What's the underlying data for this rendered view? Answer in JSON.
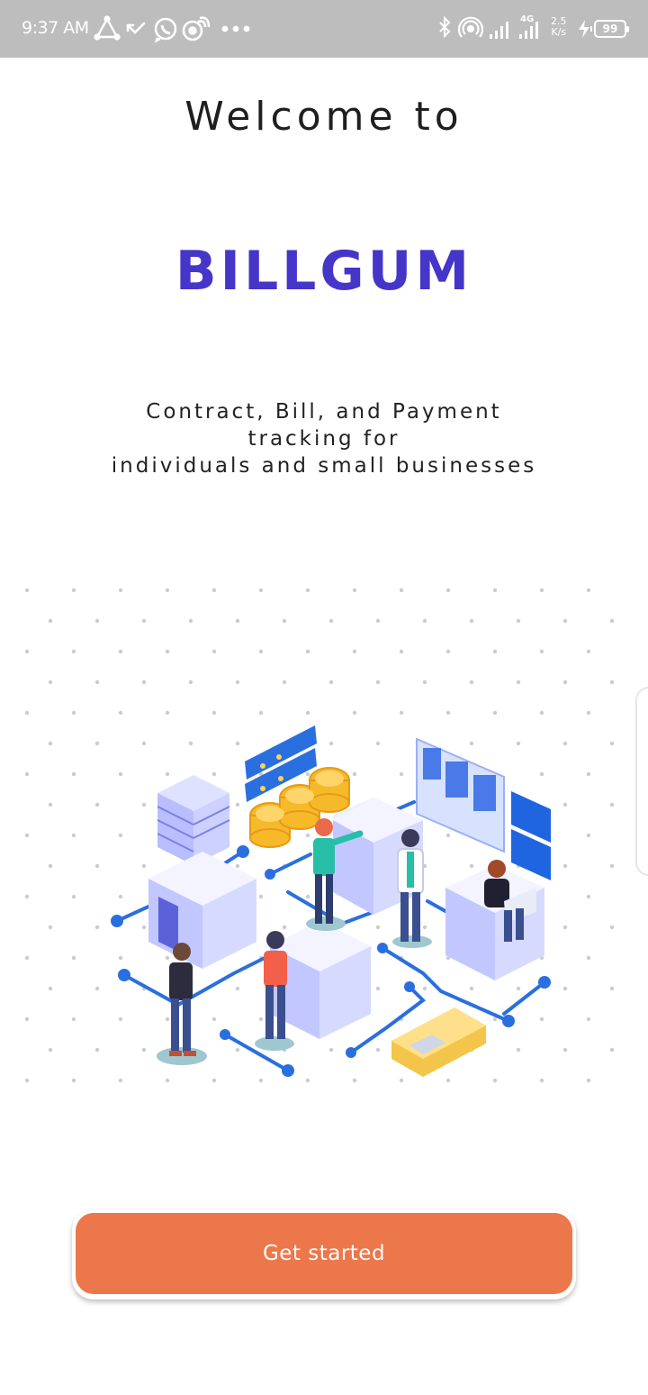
{
  "status_bar": {
    "time": "9:37 AM",
    "network_type": "4G",
    "net_speed_value": "2.5",
    "net_speed_unit": "K/s",
    "battery_level": "99",
    "icons": [
      "alert-triangle-icon",
      "missed-call-icon",
      "whatsapp-icon",
      "sync-icon",
      "more-dots-icon",
      "bluetooth-icon",
      "hotspot-icon",
      "signal-icon",
      "signal-4g-icon",
      "charging-icon",
      "battery-icon"
    ]
  },
  "main": {
    "welcome_text": "Welcome to",
    "brand_name": "BILLGUM",
    "tagline_lines": [
      "Contract, Bill, and Payment",
      "tracking for",
      "individuals and small businesses"
    ],
    "illustration": "blockchain-servers-illustration",
    "get_started_label": "Get started"
  },
  "colors": {
    "brand": "#4635c9",
    "button": "#ec774a",
    "status_bar": "#bdbdbd",
    "text": "#222222"
  }
}
